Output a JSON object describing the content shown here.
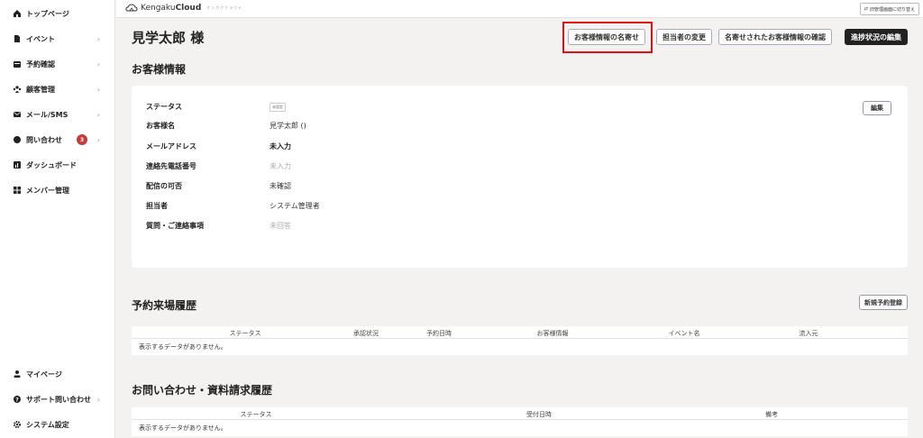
{
  "sidebar": {
    "items": [
      {
        "label": "トップページ",
        "icon": "home-icon",
        "chevron": false
      },
      {
        "label": "イベント",
        "icon": "document-icon",
        "chevron": true
      },
      {
        "label": "予約確認",
        "icon": "calendar-icon",
        "chevron": true
      },
      {
        "label": "顧客管理",
        "icon": "users-icon",
        "chevron": true
      },
      {
        "label": "メール/SMS",
        "icon": "mail-icon",
        "chevron": true
      },
      {
        "label": "問い合わせ",
        "icon": "chat-icon",
        "chevron": true,
        "badge": "3"
      },
      {
        "label": "ダッシュボード",
        "icon": "chart-icon",
        "chevron": false
      },
      {
        "label": "メンバー管理",
        "icon": "grid-icon",
        "chevron": false
      }
    ],
    "bottom_items": [
      {
        "label": "マイページ",
        "icon": "user-icon",
        "chevron": false
      },
      {
        "label": "サポート問い合わせ",
        "icon": "help-icon",
        "chevron": true
      },
      {
        "label": "システム設定",
        "icon": "gear-icon",
        "chevron": false
      }
    ]
  },
  "topbar": {
    "logo_light": "Kengaku",
    "logo_bold": "Cloud",
    "tagline": "ケンガククラウド",
    "switch_label": "旧管理画面に切り替え"
  },
  "header": {
    "title": "見学太郎 様",
    "buttons": {
      "merge": "お客様情報の名寄せ",
      "change_owner": "担当者の変更",
      "confirm_merged": "名寄せされたお客様情報の確認",
      "edit_progress": "進捗状況の編集"
    }
  },
  "customer_info": {
    "title": "お客様情報",
    "edit_label": "編集",
    "rows": [
      {
        "label": "ステータス",
        "value": "未設定"
      },
      {
        "label": "お客様名",
        "value": "見学太郎 ()"
      },
      {
        "label": "メールアドレス",
        "value": "未入力"
      },
      {
        "label": "連絡先電話番号",
        "value": "未入力"
      },
      {
        "label": "配信の可否",
        "value": "未確認"
      },
      {
        "label": "担当者",
        "value": "システム管理者"
      },
      {
        "label": "質問・ご連絡事項",
        "value": "未回答"
      }
    ]
  },
  "reservation_history": {
    "title": "予約来場履歴",
    "new_button": "新規予約登録",
    "columns": [
      "ステータス",
      "承認状況",
      "予約日時",
      "お客様情報",
      "イベント名",
      "流入元"
    ],
    "empty_text": "表示するデータがありません。"
  },
  "inquiry_history": {
    "title": "お問い合わせ・資料請求履歴",
    "columns": [
      "ステータス",
      "受付日時",
      "備考"
    ],
    "empty_text": "表示するデータがありません。"
  },
  "colors": {
    "badge": "#c73b3b",
    "highlight": "#e01010",
    "dark_button": "#222222"
  }
}
